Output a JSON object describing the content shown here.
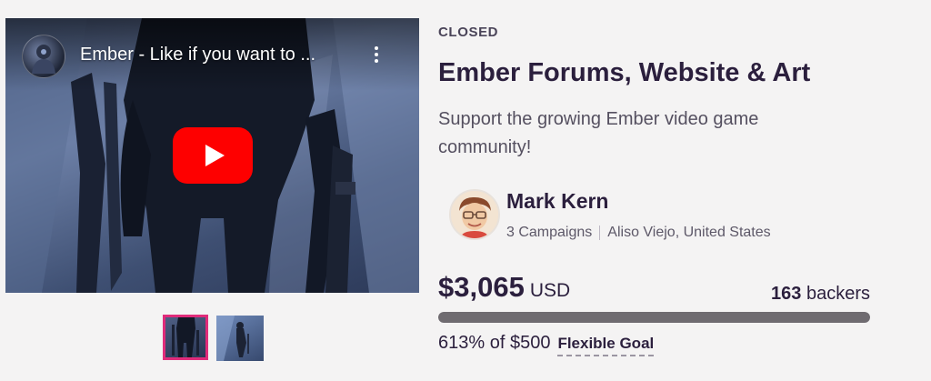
{
  "video": {
    "title": "Ember - Like if you want to ...",
    "play_icon": "youtube-play-icon",
    "more_icon": "vertical-dots-icon",
    "play_color": "#fe0000"
  },
  "gallery": {
    "thumbnails": [
      "thumbnail-1",
      "thumbnail-2"
    ],
    "selected_index": 0,
    "selected_border_color": "#e02b7a"
  },
  "campaign": {
    "status": "CLOSED",
    "title": "Ember Forums, Website & Art",
    "blurb": "Support the growing Ember video game community!"
  },
  "owner": {
    "name": "Mark Kern",
    "campaigns": "3 Campaigns",
    "location": "Aliso Viejo, United States"
  },
  "funding": {
    "amount": "$3,065",
    "currency": "USD",
    "backers_count": "163",
    "backers_label": "backers",
    "percent_text": "613% of $500",
    "goal_type": "Flexible Goal",
    "progress_fraction": 1.0
  }
}
